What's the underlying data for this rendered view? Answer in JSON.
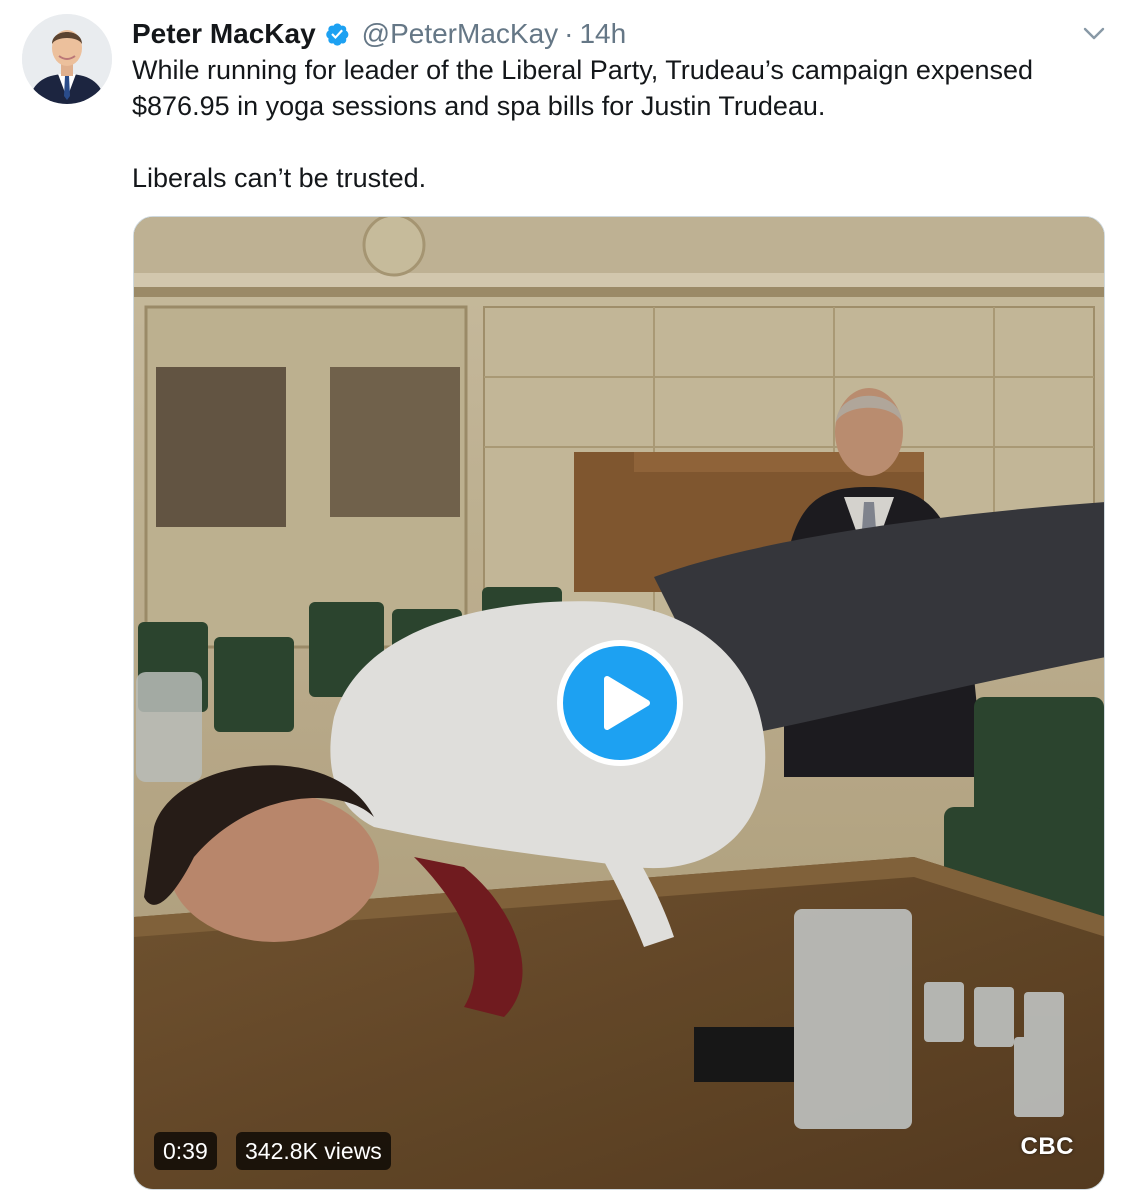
{
  "tweet": {
    "author": {
      "display_name": "Peter MacKay",
      "handle": "@PeterMacKay",
      "verified_icon": "verified-badge-icon",
      "avatar": "avatar"
    },
    "separator": "·",
    "timestamp": "14h",
    "menu_icon": "chevron-down-icon",
    "text_paragraphs": [
      "While running for leader of the Liberal Party, Trudeau’s campaign expensed $876.95 in yoga sessions and spa bills for Justin Trudeau.",
      "Liberals can’t be trusted."
    ],
    "media": {
      "type": "video",
      "duration": "0:39",
      "views": "342.8K views",
      "watermark": "CBC",
      "play_icon": "play-icon"
    }
  },
  "colors": {
    "accent": "#1da1f2",
    "text": "#14171a",
    "muted": "#657786"
  }
}
